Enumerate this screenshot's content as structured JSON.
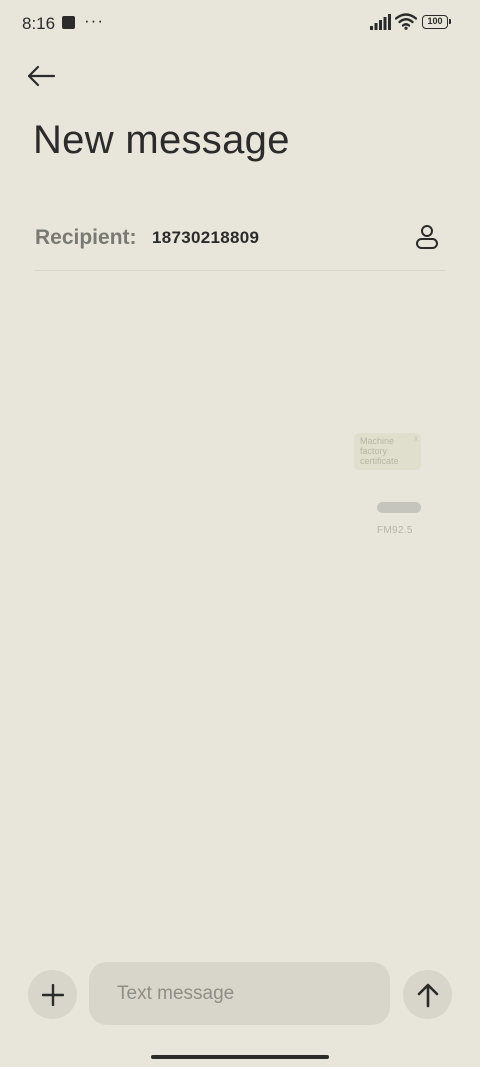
{
  "status_bar": {
    "time": "8:16",
    "notification_dots": "···",
    "battery_level": "100",
    "signal_icon": "signal-bars-icon",
    "wifi_icon": "wifi-icon"
  },
  "header": {
    "back_icon": "arrow-left-icon",
    "title": "New message"
  },
  "recipient": {
    "label": "Recipient:",
    "value": "18730218809",
    "contact_icon": "person-icon"
  },
  "overlay": {
    "card_text": "Machine factory certificate",
    "close_glyph": "x",
    "radio_label": "FM92.5"
  },
  "compose": {
    "attach_icon": "plus-icon",
    "placeholder": "Text message",
    "value": "",
    "send_icon": "arrow-up-icon"
  },
  "colors": {
    "background": "#e8e6da",
    "control_fill": "#d8d6ca",
    "text_primary": "#2b2b2b",
    "label_gray": "#7a7a74"
  }
}
